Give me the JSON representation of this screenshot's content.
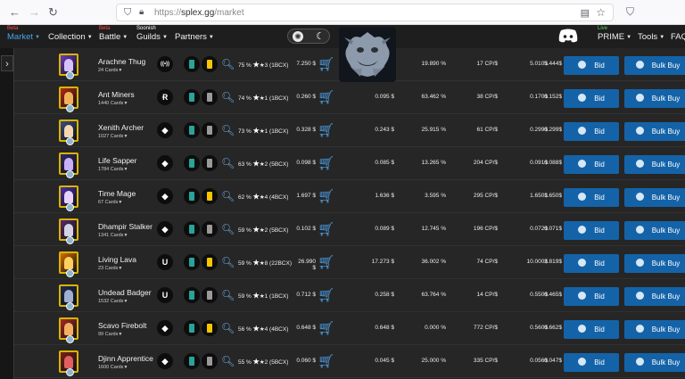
{
  "browser": {
    "url_prefix": "https://",
    "url_host": "splex.gg",
    "url_path": "/market"
  },
  "header": {
    "nav": [
      {
        "label": "Market",
        "badge": "Beta",
        "active": true
      },
      {
        "label": "Collection"
      },
      {
        "label": "Battle",
        "badge": "Beta"
      },
      {
        "label": "Guilds",
        "badge": "Soonish"
      },
      {
        "label": "Partners"
      }
    ],
    "right": [
      {
        "label": "PRIME",
        "badge": "Live"
      },
      {
        "label": "Tools"
      },
      {
        "label": "FAQ"
      }
    ]
  },
  "rows": [
    {
      "name": "Arachne Thug",
      "cards": "24 Cards",
      "edition_icon": "wifi",
      "pct": "75 %",
      "stars": "★3 (1BCX)",
      "price": "7.250 $",
      "c1": "",
      "c2": "19.890 %",
      "c3": "17 CP/$",
      "c4": "5.010$",
      "c5": "5.444$",
      "color": "#6a3cc2",
      "fig": "#d7c2ff",
      "foil": "#f3c600"
    },
    {
      "name": "Ant Miners",
      "cards": "1440 Cards",
      "edition_icon": "R",
      "pct": "74 %",
      "stars": "★1 (1BCX)",
      "price": "0.260 $",
      "c1": "0.095 $",
      "c2": "63.462 %",
      "c3": "38 CP/$",
      "c4": "0.170$",
      "c5": "0.152$",
      "color": "#b52a16",
      "fig": "#f0b25a",
      "foil": "#9a9a9a"
    },
    {
      "name": "Xenith Archer",
      "cards": "1027 Cards",
      "edition_icon": "◆",
      "pct": "73 %",
      "stars": "★1 (1BCX)",
      "price": "0.328 $",
      "c1": "0.243 $",
      "c2": "25.915 %",
      "c3": "61 CP/$",
      "c4": "0.299$",
      "c5": "0.299$",
      "color": "#3d4d82",
      "fig": "#f4d6b0",
      "foil": "#9a9a9a"
    },
    {
      "name": "Life Sapper",
      "cards": "1784 Cards",
      "edition_icon": "◆",
      "pct": "63 %",
      "stars": "★2 (5BCX)",
      "price": "0.098 $",
      "c1": "0.085 $",
      "c2": "13.265 %",
      "c3": "204 CP/$",
      "c4": "0.091$",
      "c5": "0.088$",
      "color": "#2d2a6a",
      "fig": "#c8b0ff",
      "foil": "#9a9a9a"
    },
    {
      "name": "Time Mage",
      "cards": "67 Cards",
      "edition_icon": "◆",
      "pct": "62 %",
      "stars": "★4 (4BCX)",
      "price": "1.697 $",
      "c1": "1.636 $",
      "c2": "3.595 %",
      "c3": "295 CP/$",
      "c4": "1.650$",
      "c5": "1.650$",
      "color": "#4a2fa8",
      "fig": "#e7d1ff",
      "foil": "#f3c600"
    },
    {
      "name": "Dhampir Stalker",
      "cards": "1341 Cards",
      "edition_icon": "◆",
      "pct": "59 %",
      "stars": "★2 (5BCX)",
      "price": "0.102 $",
      "c1": "0.089 $",
      "c2": "12.745 %",
      "c3": "196 CP/$",
      "c4": "0.072$",
      "c5": "0.071$",
      "color": "#5a2a6e",
      "fig": "#d4d4e6",
      "foil": "#9a9a9a"
    },
    {
      "name": "Living Lava",
      "cards": "23 Cards",
      "edition_icon": "U",
      "pct": "59 %",
      "stars": "★8 (22BCX)",
      "price": "26.990 $",
      "c1": "17.273 $",
      "c2": "36.002 %",
      "c3": "74 CP/$",
      "c4": "10.000$",
      "c5": "2.819$",
      "color": "#d46a00",
      "fig": "#ffd060",
      "foil": "#f3c600"
    },
    {
      "name": "Undead Badger",
      "cards": "1532 Cards",
      "edition_icon": "U",
      "pct": "59 %",
      "stars": "★1 (1BCX)",
      "price": "0.712 $",
      "c1": "0.258 $",
      "c2": "63.764 %",
      "c3": "14 CP/$",
      "c4": "0.550$",
      "c5": "0.465$",
      "color": "#202a52",
      "fig": "#9fb0d0",
      "foil": "#9a9a9a"
    },
    {
      "name": "Scavo Firebolt",
      "cards": "99 Cards",
      "edition_icon": "◆",
      "pct": "56 %",
      "stars": "★4 (4BCX)",
      "price": "0.648 $",
      "c1": "0.648 $",
      "c2": "0.000 %",
      "c3": "772 CP/$",
      "c4": "0.560$",
      "c5": "0.662$",
      "color": "#a82a2a",
      "fig": "#f3b060",
      "foil": "#f3c600"
    },
    {
      "name": "Djinn Apprentice",
      "cards": "1600 Cards",
      "edition_icon": "◆",
      "pct": "55 %",
      "stars": "★2 (5BCX)",
      "price": "0.060 $",
      "c1": "0.045 $",
      "c2": "25.000 %",
      "c3": "335 CP/$",
      "c4": "0.056$",
      "c5": "0.047$",
      "color": "#7a1f1f",
      "fig": "#e06060",
      "foil": "#9a9a9a"
    }
  ],
  "labels": {
    "bid": "Bid",
    "bulk": "Bulk Buy"
  }
}
